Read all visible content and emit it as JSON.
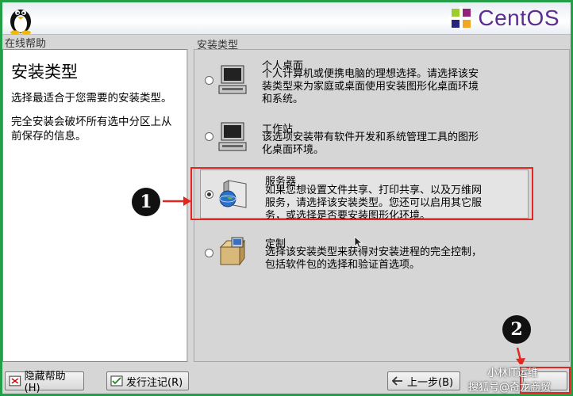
{
  "banner": {
    "logo_text": "CentOS"
  },
  "help": {
    "section_label": "在线帮助",
    "title": "安装类型",
    "para1": "选择最适合于您需要的安装类型。",
    "para2": "完全安装会破坏所有选中分区上从前保存的信息。"
  },
  "install_type": {
    "section_label": "安装类型",
    "options": [
      {
        "title": "个人桌面",
        "desc1": "个人计算机或便携电脑的理想选择。请选择该安",
        "desc2": "装类型来为家庭或桌面使用安装图形化桌面环境",
        "desc3": "和系统。",
        "icon": "desktop-computer-icon",
        "selected": false
      },
      {
        "title": "工作站",
        "desc1": "该选项安装带有软件开发和系统管理工具的图形",
        "desc2": "化桌面环境。",
        "desc3": "",
        "icon": "workstation-computer-icon",
        "selected": false
      },
      {
        "title": "服务器",
        "desc1": "如果您想设置文件共享、打印共享、以及万维网",
        "desc2": "服务，请选择该安装类型。您还可以启用其它服",
        "desc3": "务，或选择是否要安装图形化环境。",
        "icon": "server-globe-icon",
        "selected": true
      },
      {
        "title": "定制",
        "desc1": "选择该安装类型来获得对安装进程的完全控制，",
        "desc2": "包括软件包的选择和验证首选项。",
        "desc3": "",
        "icon": "custom-package-icon",
        "selected": false
      }
    ]
  },
  "annotations": {
    "badge1": "1",
    "badge2": "2"
  },
  "buttons": {
    "hide_help": "隐藏帮助(H)",
    "release_notes": "发行注记(R)",
    "back": "上一步(B)"
  },
  "watermark": {
    "line1": "小林IT运维",
    "line2": "搜狐号@奇龙商贸"
  },
  "colors": {
    "annotation_red": "#e52521",
    "frame_green": "#23a047",
    "logo_purple": "#5c2d91"
  }
}
